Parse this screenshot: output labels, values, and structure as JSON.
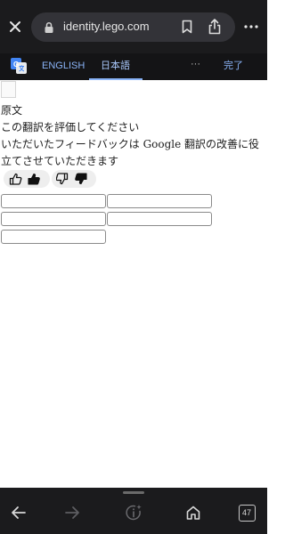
{
  "browser": {
    "url": "identity.lego.com",
    "tabs_count": "47"
  },
  "translate_bar": {
    "languages": [
      "ENGLISH",
      "日本語"
    ],
    "more_label": "···",
    "done_label": "完了"
  },
  "feedback": {
    "original_label": "原文",
    "rate_title": "この翻訳を評価してください",
    "description": "いただいたフィードバックは Google 翻訳の改善に役立てさせていただきます"
  },
  "colors": {
    "chrome_bg": "#1b1b1d",
    "translate_bar_bg": "#141416",
    "accent": "#8ab4f8"
  },
  "icons": [
    "close-icon",
    "lock-icon",
    "bookmark-icon",
    "share-icon",
    "more-icon",
    "google-translate-icon",
    "thumbs-up-icon",
    "thumbs-down-icon",
    "back-arrow-icon",
    "forward-arrow-icon",
    "sparkle-info-icon",
    "home-icon",
    "tabs-icon"
  ]
}
